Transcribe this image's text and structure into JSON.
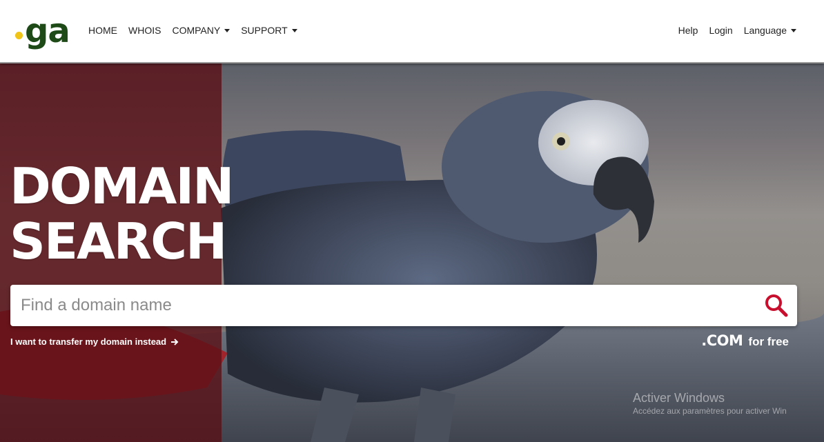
{
  "logo": {
    "text": "ga"
  },
  "nav": {
    "left": [
      "HOME",
      "WHOIS",
      "COMPANY",
      "SUPPORT"
    ],
    "right": [
      "Help",
      "Login",
      "Language"
    ]
  },
  "hero": {
    "title_line1": "DOMAIN",
    "title_line2": "SEARCH",
    "search_placeholder": "Find a domain name",
    "transfer_link": "I want to transfer my domain instead",
    "promo_com": ".COM",
    "promo_free": "for free"
  },
  "watermark": {
    "title": "Activer Windows",
    "subtitle": "Accédez aux paramètres pour activer Win"
  },
  "colors": {
    "logo_green": "#1d4a17",
    "logo_dot_yellow": "#f0c419",
    "overlay_maroon": "#5a1016",
    "search_icon_red": "#c8102e"
  }
}
